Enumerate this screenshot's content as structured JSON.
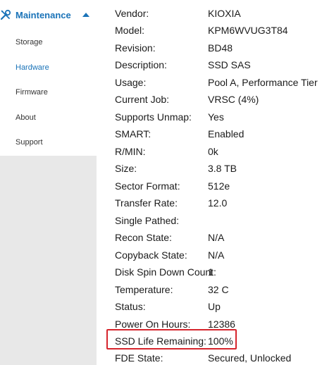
{
  "sidebar": {
    "section_title": "Maintenance",
    "section_icon": "tools-icon",
    "collapse_icon": "chevron-up-icon",
    "accent_color": "#1a73b8",
    "items": [
      {
        "label": "Storage",
        "active": false
      },
      {
        "label": "Hardware",
        "active": true
      },
      {
        "label": "Firmware",
        "active": false
      },
      {
        "label": "About",
        "active": false
      },
      {
        "label": "Support",
        "active": false
      }
    ]
  },
  "details": {
    "rows": [
      {
        "label": "Vendor:",
        "value": "KIOXIA"
      },
      {
        "label": "Model:",
        "value": "KPM6WVUG3T84"
      },
      {
        "label": "Revision:",
        "value": "BD48"
      },
      {
        "label": "Description:",
        "value": "SSD SAS"
      },
      {
        "label": "Usage:",
        "value": "Pool A, Performance Tier"
      },
      {
        "label": "Current Job:",
        "value": "VRSC (4%)"
      },
      {
        "label": "Supports Unmap:",
        "value": "Yes"
      },
      {
        "label": "SMART:",
        "value": "Enabled"
      },
      {
        "label": "R/MIN:",
        "value": "0k"
      },
      {
        "label": "Size:",
        "value": "3.8 TB"
      },
      {
        "label": "Sector Format:",
        "value": "512e"
      },
      {
        "label": "Transfer Rate:",
        "value": "12.0"
      },
      {
        "label": "Single Pathed:",
        "value": ""
      },
      {
        "label": "Recon State:",
        "value": "N/A"
      },
      {
        "label": "Copyback State:",
        "value": "N/A"
      },
      {
        "label": "Disk Spin Down Count:",
        "value": "1"
      },
      {
        "label": "Temperature:",
        "value": "32 C"
      },
      {
        "label": "Status:",
        "value": "Up"
      },
      {
        "label": "Power On Hours:",
        "value": "12386"
      },
      {
        "label": "SSD Life Remaining:",
        "value": "100%"
      },
      {
        "label": "FDE State:",
        "value": "Secured, Unlocked"
      }
    ],
    "highlighted_row": 19,
    "highlight_color": "#d6252d"
  }
}
